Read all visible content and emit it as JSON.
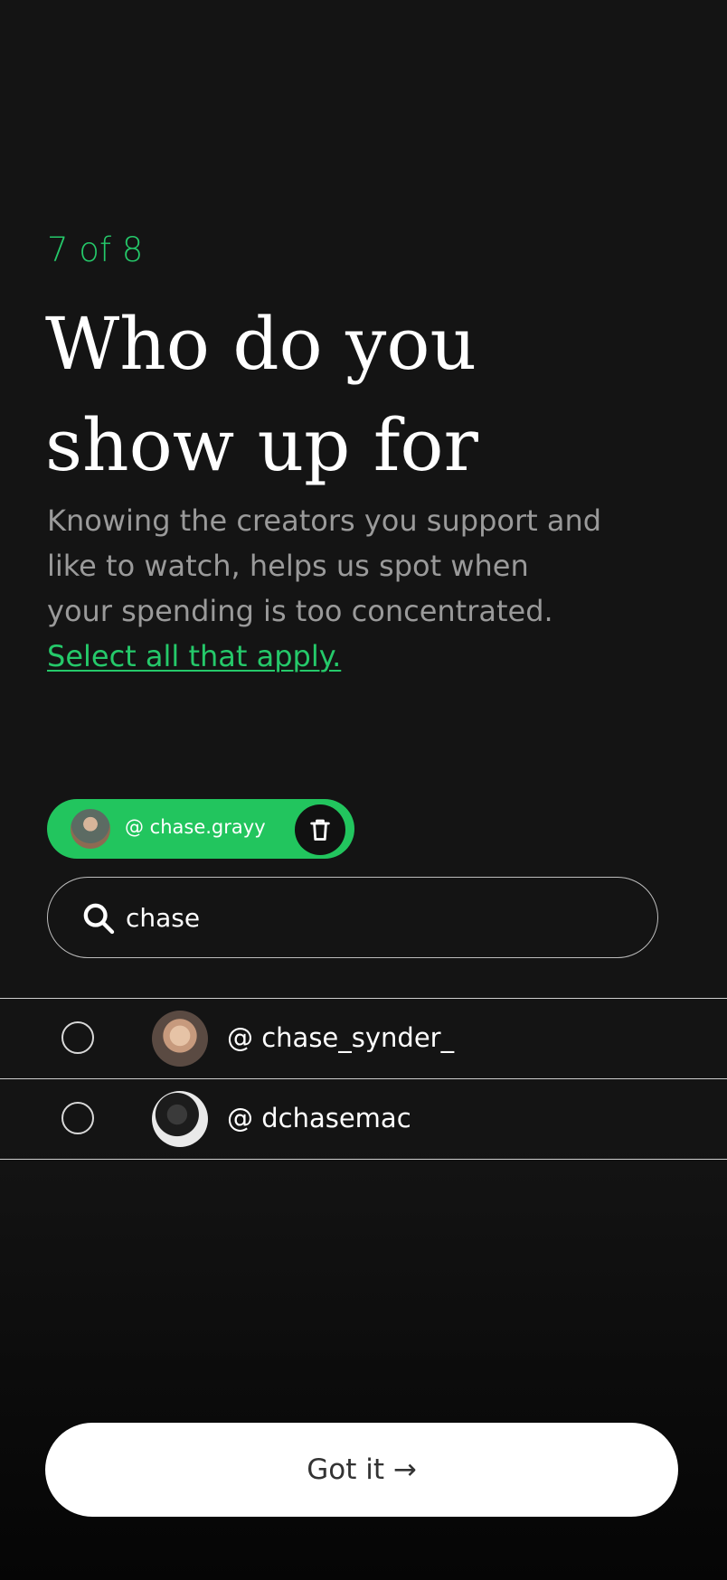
{
  "progress": {
    "step_label": "7 of 8"
  },
  "heading": {
    "title_line1": "Who do you",
    "title_line2": "show up for",
    "subtitle_lines": [
      "Knowing the creators you support and",
      "like to watch, helps us spot when",
      "your spending is too concentrated."
    ],
    "select_link": "Select all that apply."
  },
  "selected": [
    {
      "handle": "@ chase.grayy",
      "delete_icon": "trash-icon"
    }
  ],
  "search": {
    "value": "chase",
    "icon": "search-icon"
  },
  "results": [
    {
      "handle": "@ chase_synder_",
      "selected": false
    },
    {
      "handle": "@ dchasemac",
      "selected": false
    }
  ],
  "cta": {
    "label": "Got it →"
  },
  "colors": {
    "background": "#141414",
    "accent": "#22c55e",
    "text_muted": "#9a9a9a"
  }
}
